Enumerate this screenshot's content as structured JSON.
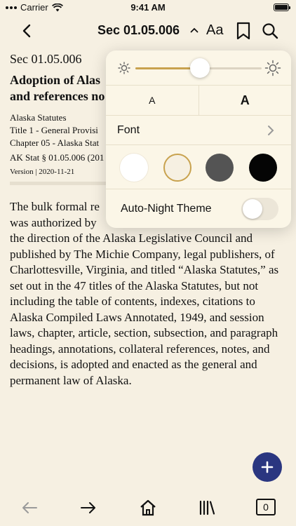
{
  "status_bar": {
    "carrier": "Carrier",
    "time": "9:41 AM"
  },
  "nav": {
    "title": "Sec 01.05.006",
    "caret": "^",
    "font_button": "Aa"
  },
  "document": {
    "section_label": "Sec 01.05.006",
    "heading_line1": "Adoption of Alas",
    "heading_line2": "and references no",
    "source": "Alaska Statutes",
    "title_line": "Title 1 - General Provisi",
    "chapter_line": "Chapter 05 - Alaska Stat",
    "citation": "AK Stat § 01.05.006 (201",
    "version": "Version | 2020-11-21",
    "body_line1": "The bulk formal re",
    "body_line2": "was authorized by",
    "body_rest": "the direction of the Alaska Legislative Council and published by The Michie Company, legal publishers, of Charlottesville, Virginia, and titled “Alaska Statutes,” as set out in the 47 titles of the Alaska Statutes, but not including the table of contents, indexes, citations to Alaska Compiled Laws Annotated, 1949, and session laws, chapter, article, section, subsection, and paragraph headings, annotations, collateral references, notes, and decisions, is adopted and enacted as the general and permanent law of Alaska."
  },
  "popover": {
    "brightness_fraction": 0.51,
    "size_small": "A",
    "size_large": "A",
    "font_label": "Font",
    "themes": [
      {
        "name": "white",
        "color": "#ffffff",
        "selected": false
      },
      {
        "name": "sepia",
        "color": "#f6f0e2",
        "selected": true
      },
      {
        "name": "gray",
        "color": "#545454",
        "selected": false
      },
      {
        "name": "black",
        "color": "#050505",
        "selected": false
      }
    ],
    "auto_night_label": "Auto-Night Theme",
    "auto_night_on": false
  },
  "colors": {
    "accent": "#c8a24e",
    "fab": "#2a3680",
    "background": "#f6f0e2"
  },
  "toolbar": {
    "tab_count": "0"
  }
}
